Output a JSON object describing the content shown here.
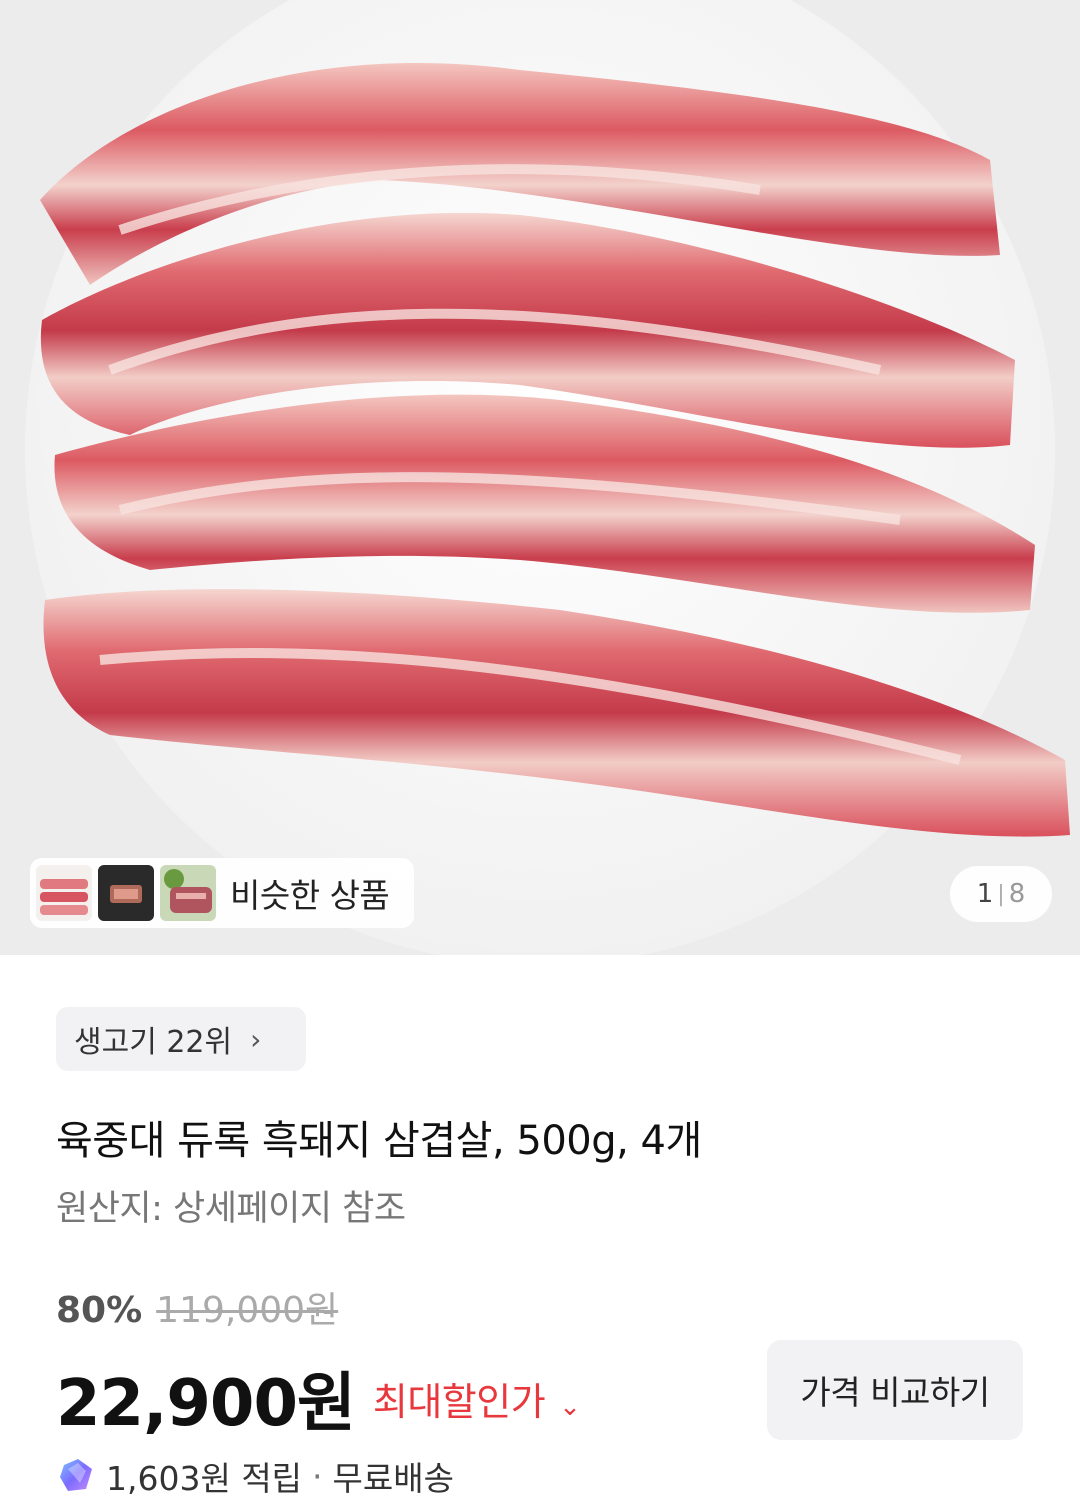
{
  "gallery": {
    "similar_label": "비슷한 상품",
    "counter_current": "1",
    "counter_separator": "|",
    "counter_total": "8"
  },
  "product": {
    "rank_chip": "생고기 22위",
    "rank_chevron": "›",
    "title": "육중대 듀록 흑돼지 삼겹살, 500g, 4개",
    "origin": "원산지: 상세페이지 참조",
    "discount_percent": "80%",
    "original_price": "119,000원",
    "price": "22,900원",
    "max_discount_label": "최대할인가",
    "max_discount_caret": "⌄",
    "compare_button": "가격 비교하기",
    "reward_points": "1,603원 적립",
    "separator": "·",
    "shipping": "무료배송"
  },
  "colors": {
    "accent_red": "#e8383d",
    "chip_bg": "#f2f2f4"
  },
  "icons": {
    "reward": "diamond-reward-icon",
    "chevron": "chevron-right-icon",
    "caret": "chevron-down-icon"
  }
}
